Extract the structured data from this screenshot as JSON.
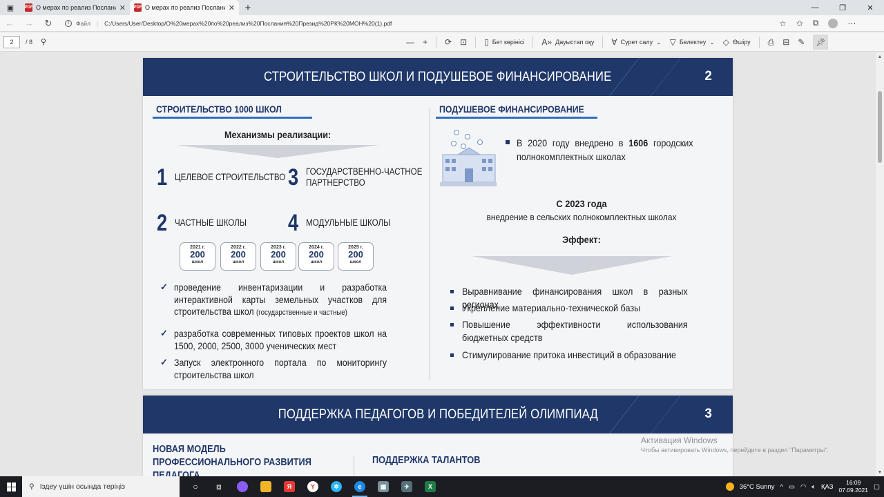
{
  "browser": {
    "tabs": [
      {
        "title": "О мерах по реализ Послания П"
      },
      {
        "title": "О мерах по реализ Послания П"
      }
    ],
    "new_tab": "+",
    "file_label": "Файл",
    "url": "C:/Users/User/Desktop/О%20мерах%20по%20реализ%20Послания%20Презид%20РК%20МОН%20(1).pdf"
  },
  "pdf_toolbar": {
    "page_current": "2",
    "page_total": "/ 8",
    "zoom_out": "—",
    "zoom_in": "+",
    "page_view": "Бет көрінісі",
    "read_aloud": "Дауыстап оқу",
    "draw": "Сурет салу",
    "highlight": "Белектеу",
    "erase": "Өшіру"
  },
  "slide1": {
    "title": "СТРОИТЕЛЬСТВО ШКОЛ И ПОДУШЕВОЕ ФИНАНСИРОВАНИЕ",
    "number": "2",
    "left_title": "СТРОИТЕЛЬСТВО 1000 ШКОЛ",
    "mechanisms_title": "Механизмы реализации:",
    "mechanisms": [
      {
        "num": "1",
        "label": "ЦЕЛЕВОЕ СТРОИТЕЛЬСТВО"
      },
      {
        "num": "3",
        "label": "ГОСУДАРСТВЕННО-ЧАСТНОЕ\nПАРТНЕРСТВО"
      },
      {
        "num": "2",
        "label": "ЧАСТНЫЕ ШКОЛЫ"
      },
      {
        "num": "4",
        "label": "МОДУЛЬНЫЕ ШКОЛЫ"
      }
    ],
    "years": [
      {
        "year": "2021 г.",
        "value": "200",
        "unit": "школ"
      },
      {
        "year": "2022 г.",
        "value": "200",
        "unit": "школ"
      },
      {
        "year": "2023 г.",
        "value": "200",
        "unit": "школ"
      },
      {
        "year": "2024 г.",
        "value": "200",
        "unit": "школ"
      },
      {
        "year": "2025 г.",
        "value": "200",
        "unit": "школ"
      }
    ],
    "checks": [
      {
        "text": "проведение инвентаризации и разработка интерактивной карты земельных участков для строительства школ",
        "small": "(государственные и частные)"
      },
      {
        "text": "разработка современных типовых проектов школ на 1500, 2000, 2500, 3000 ученических мест",
        "small": ""
      },
      {
        "text": "Запуск электронного портала по мониторингу строительства школ",
        "small": ""
      }
    ],
    "right_title": "ПОДУШЕВОЕ ФИНАНСИРОВАНИЕ",
    "bullet_pre": "В 2020 году внедрено в ",
    "bullet_bold": "1606",
    "bullet_post": " городских полнокомплектных школах",
    "since_title": "С 2023 года",
    "since_text": "внедрение в сельских полнокомплектных школах",
    "effect_title": "Эффект:",
    "effects": [
      "Выравнивание финансирования школ в разных регионах",
      "Укрепление материально-технической базы",
      "Повышение эффективности использования бюджетных средств",
      "Стимулирование притока инвестиций в образование"
    ]
  },
  "slide2": {
    "title": "ПОДДЕРЖКА ПЕДАГОГОВ И ПОБЕДИТЕЛЕЙ ОЛИМПИАД",
    "number": "3",
    "left_title_1": "НОВАЯ МОДЕЛЬ",
    "left_title_2": "ПРОФЕССИОНАЛЬНОГО РАЗВИТИЯ",
    "left_title_3": "ПЕДАГОГА",
    "right_title": "ПОДДЕРЖКА ТАЛАНТОВ"
  },
  "watermark": {
    "line1": "Активация Windows",
    "line2": "Чтобы активировать Windows, перейдите в раздел \"Параметры\"."
  },
  "taskbar": {
    "search_placeholder": "Іздеу үшін осында теріңіз",
    "weather": "36°C  Sunny",
    "lang": "ҚАЗ",
    "time": "16:09",
    "date": "07.09.2021"
  },
  "colors": {
    "header_navy": "#1f3769",
    "accent_blue": "#2e6fc0",
    "pdf_red": "#c62828"
  }
}
